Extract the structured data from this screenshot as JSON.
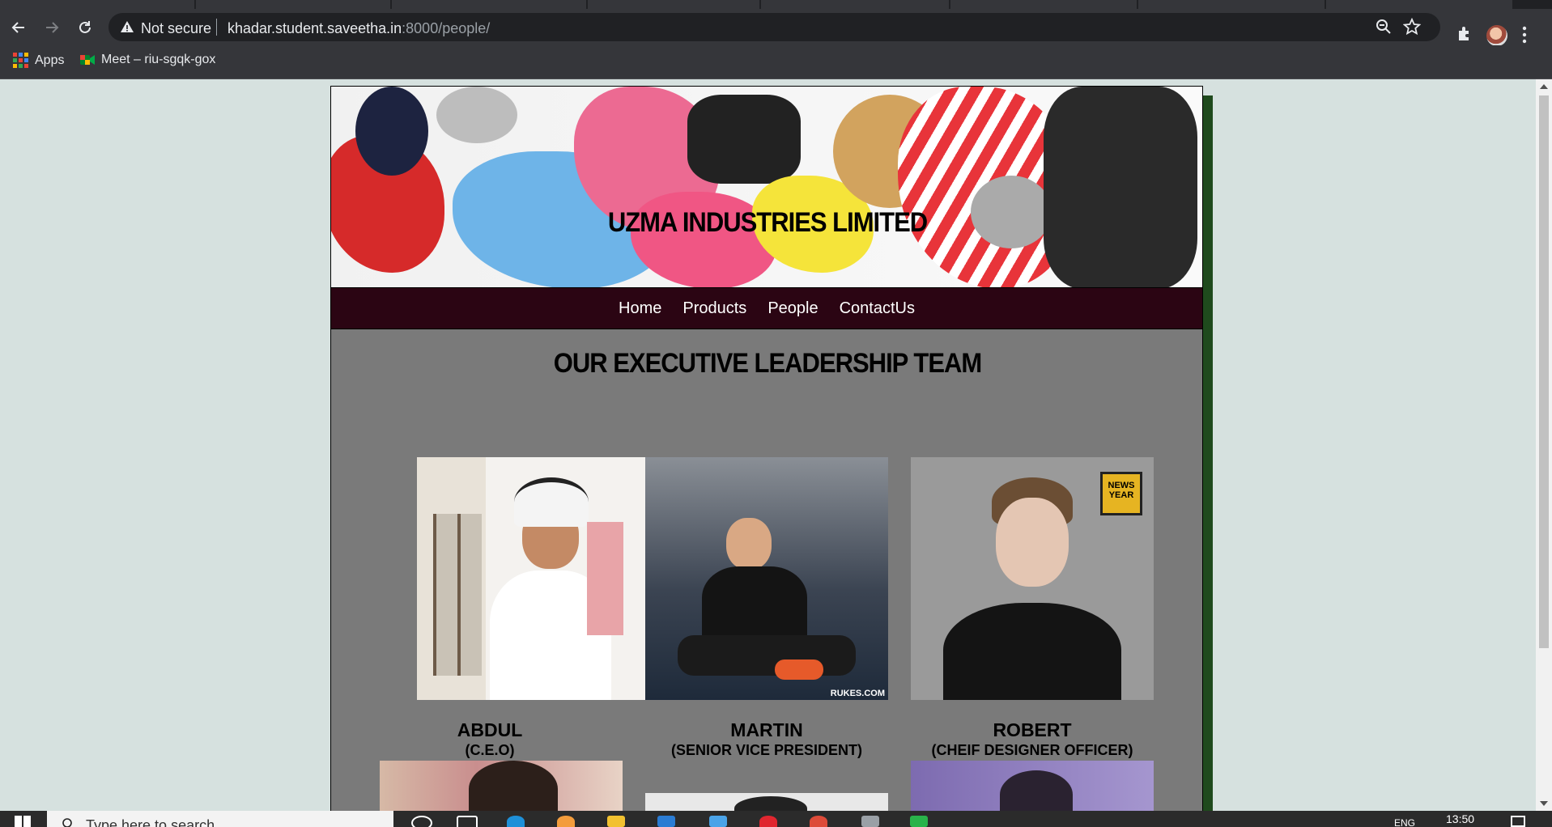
{
  "browser": {
    "security_label": "Not secure",
    "url_host": "khadar.student.saveetha.in",
    "url_path": ":8000/people/",
    "bookmarks": [
      {
        "label": "Apps"
      },
      {
        "label": "Meet – riu-sgqk-gox"
      }
    ]
  },
  "site": {
    "banner_title": "UZMA INDUSTRIES LIMITED",
    "nav": [
      "Home",
      "Products",
      "People",
      "ContactUs"
    ],
    "section_title": "OUR EXECUTIVE LEADERSHIP TEAM",
    "people": [
      {
        "name": "ABDUL",
        "role": "(C.E.O)"
      },
      {
        "name": "MARTIN",
        "role": "(SENIOR VICE PRESIDENT)"
      },
      {
        "name": "ROBERT",
        "role": "(CHEIF DESIGNER OFFICER)"
      }
    ],
    "photo_text": {
      "news_badge": "NEWS YEAR",
      "watermark": "RUKES.COM"
    }
  },
  "taskbar": {
    "search_placeholder": "Type here to search",
    "time": "13:50",
    "lang": "ENG"
  }
}
